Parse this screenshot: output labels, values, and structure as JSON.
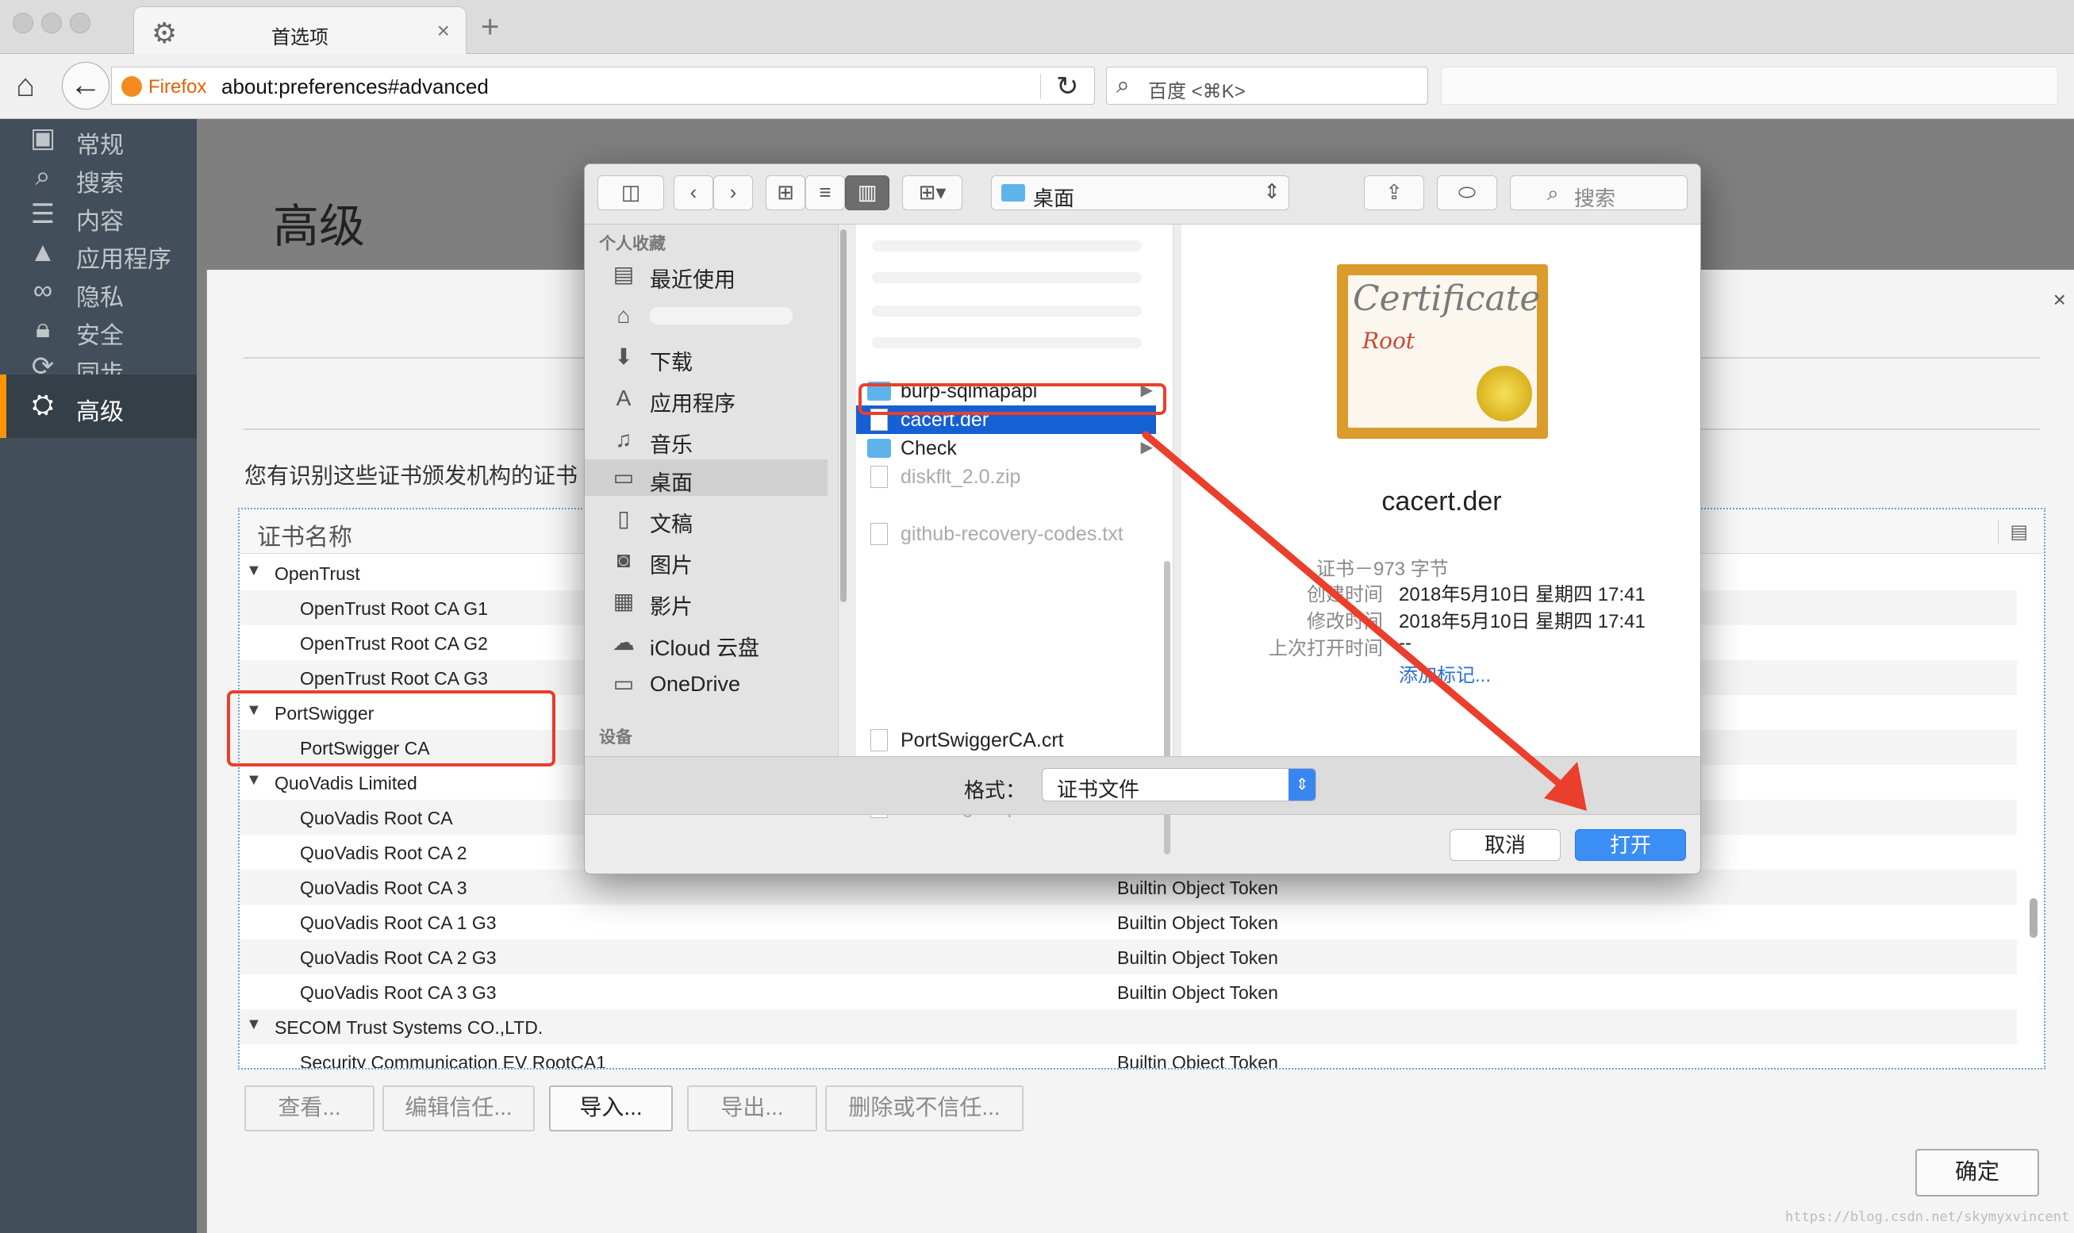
{
  "browser": {
    "tab_title": "首选项",
    "url_brand": "Firefox",
    "url": "about:preferences#advanced",
    "search_placeholder": "百度 <⌘K>"
  },
  "sidebar": {
    "items": [
      {
        "label": "常规",
        "icon": "general-icon"
      },
      {
        "label": "搜索",
        "icon": "search-icon"
      },
      {
        "label": "内容",
        "icon": "content-icon"
      },
      {
        "label": "应用程序",
        "icon": "applications-icon"
      },
      {
        "label": "隐私",
        "icon": "privacy-mask-icon"
      },
      {
        "label": "安全",
        "icon": "lock-icon"
      },
      {
        "label": "同步",
        "icon": "sync-icon"
      },
      {
        "label": "高级",
        "icon": "advanced-icon"
      }
    ],
    "active": "高级"
  },
  "page": {
    "heading": "高级"
  },
  "cert_manager": {
    "description": "您有识别这些证书颁发机构的证书",
    "column_header": "证书名称",
    "rows": [
      {
        "name": "OpenTrust",
        "group": true,
        "token": ""
      },
      {
        "name": "OpenTrust Root CA G1",
        "group": false,
        "token": ""
      },
      {
        "name": "OpenTrust Root CA G2",
        "group": false,
        "token": ""
      },
      {
        "name": "OpenTrust Root CA G3",
        "group": false,
        "token": ""
      },
      {
        "name": "PortSwigger",
        "group": true,
        "token": ""
      },
      {
        "name": "PortSwigger CA",
        "group": false,
        "token": ""
      },
      {
        "name": "QuoVadis Limited",
        "group": true,
        "token": ""
      },
      {
        "name": "QuoVadis Root CA",
        "group": false,
        "token": ""
      },
      {
        "name": "QuoVadis Root CA 2",
        "group": false,
        "token": ""
      },
      {
        "name": "QuoVadis Root CA 3",
        "group": false,
        "token": "Builtin Object Token"
      },
      {
        "name": "QuoVadis Root CA 1 G3",
        "group": false,
        "token": "Builtin Object Token"
      },
      {
        "name": "QuoVadis Root CA 2 G3",
        "group": false,
        "token": "Builtin Object Token"
      },
      {
        "name": "QuoVadis Root CA 3 G3",
        "group": false,
        "token": "Builtin Object Token"
      },
      {
        "name": "SECOM Trust Systems CO.,LTD.",
        "group": true,
        "token": ""
      },
      {
        "name": "Security Communication EV RootCA1",
        "group": false,
        "token": "Builtin Object Token"
      }
    ],
    "buttons": {
      "view": "查看...",
      "edit_trust": "编辑信任...",
      "import": "导入...",
      "export": "导出...",
      "delete": "删除或不信任..."
    },
    "ok": "确定"
  },
  "dialog": {
    "location": "桌面",
    "search_placeholder": "搜索",
    "favorites_heading": "个人收藏",
    "devices_heading": "设备",
    "favorites": [
      {
        "label": "最近使用",
        "icon": "recents-icon"
      },
      {
        "label": "",
        "icon": "home-icon"
      },
      {
        "label": "下载",
        "icon": "download-icon"
      },
      {
        "label": "应用程序",
        "icon": "applications-icon"
      },
      {
        "label": "音乐",
        "icon": "music-icon"
      },
      {
        "label": "桌面",
        "icon": "desktop-icon"
      },
      {
        "label": "文稿",
        "icon": "documents-icon"
      },
      {
        "label": "图片",
        "icon": "pictures-icon"
      },
      {
        "label": "影片",
        "icon": "movies-icon"
      },
      {
        "label": "iCloud 云盘",
        "icon": "cloud-icon"
      },
      {
        "label": "OneDrive",
        "icon": "folder-icon"
      }
    ],
    "files": [
      {
        "name": "burp-sqlmapapi",
        "kind": "folder",
        "dim": false,
        "chevron": true
      },
      {
        "name": "cacert.der",
        "kind": "doc",
        "dim": false,
        "chevron": false
      },
      {
        "name": "Check",
        "kind": "folder",
        "dim": false,
        "chevron": true
      },
      {
        "name": "diskflt_2.0.zip",
        "kind": "zip",
        "dim": true,
        "chevron": false
      },
      {
        "name": "github-recovery-codes.txt",
        "kind": "doc",
        "dim": true,
        "chevron": false
      },
      {
        "name": "PortSwiggerCA.crt",
        "kind": "doc",
        "dim": false,
        "chevron": false
      },
      {
        "name": "xinwang.burp",
        "kind": "doc",
        "dim": true,
        "chevron": false
      }
    ],
    "selected_file": "cacert.der",
    "preview": {
      "image_text_1": "Certificate",
      "image_text_2": "Root",
      "name": "cacert.der",
      "kind_size": "证书－973 字节",
      "created_label": "创建时间",
      "created": "2018年5月10日 星期四 17:41",
      "modified_label": "修改时间",
      "modified": "2018年5月10日 星期四 17:41",
      "last_opened_label": "上次打开时间",
      "last_opened": "--",
      "add_tags": "添加标记..."
    },
    "format_label": "格式：",
    "format_value": "证书文件",
    "cancel": "取消",
    "open": "打开"
  },
  "watermark": "https://blog.csdn.net/skymyxvincent",
  "colors": {
    "annotation_red": "#ea3f2c",
    "selection_blue": "#1560d4",
    "sidebar_bg": "#424f5a",
    "sidebar_accent": "#ff9500"
  }
}
